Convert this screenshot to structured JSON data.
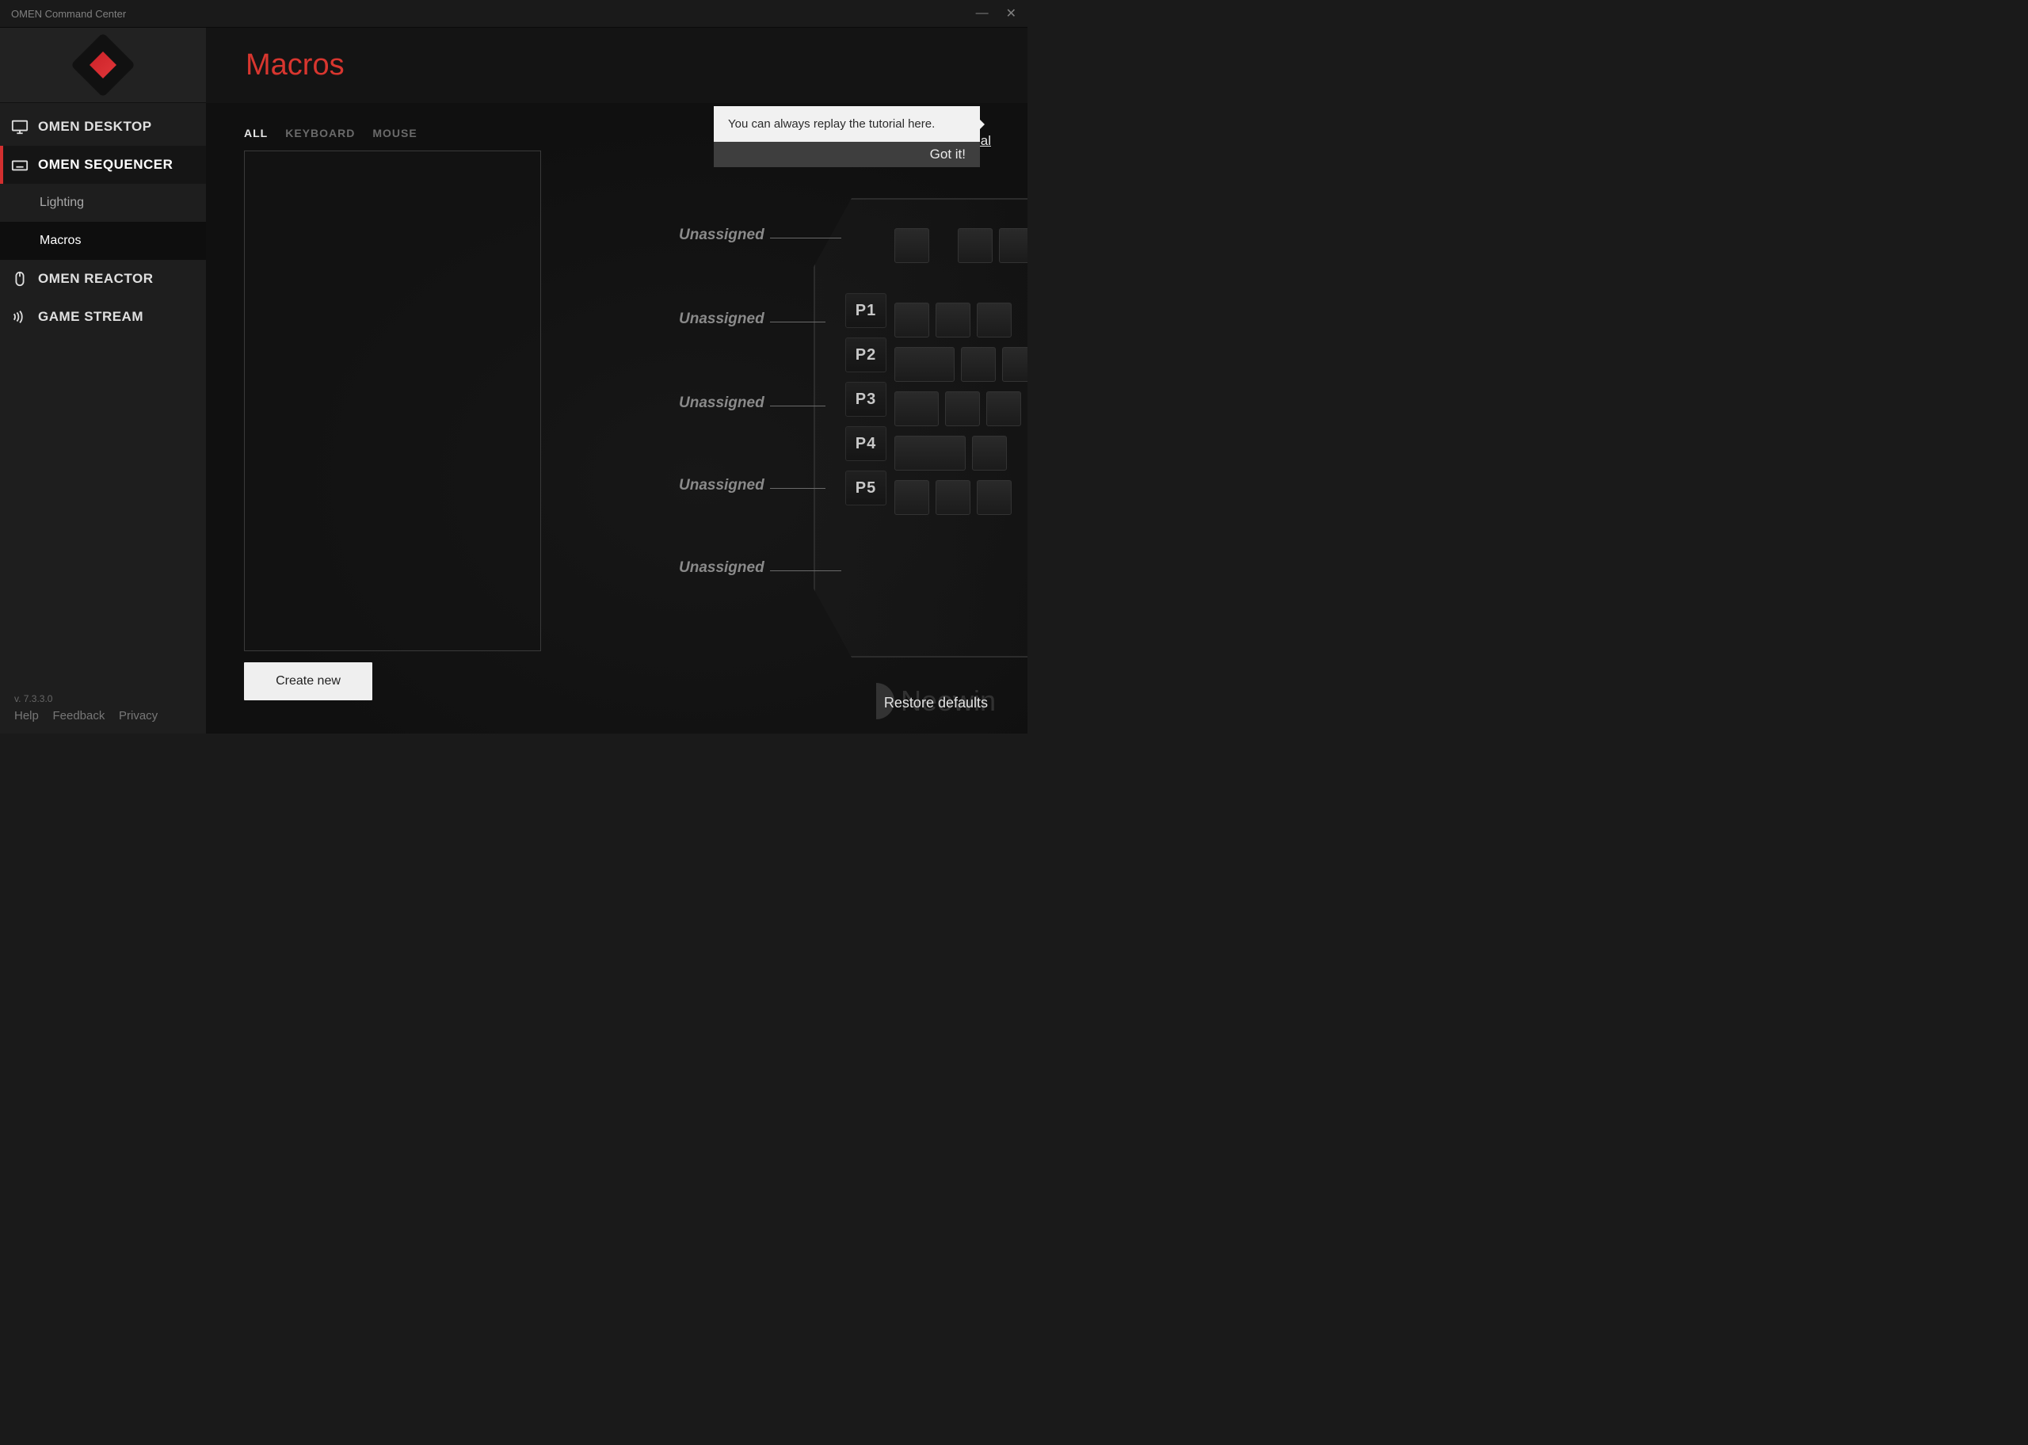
{
  "window": {
    "title": "OMEN Command Center"
  },
  "sidebar": {
    "items": [
      {
        "label": "OMEN DESKTOP"
      },
      {
        "label": "OMEN SEQUENCER"
      },
      {
        "label": "OMEN REACTOR"
      },
      {
        "label": "GAME STREAM"
      }
    ],
    "subitems": [
      {
        "label": "Lighting"
      },
      {
        "label": "Macros"
      }
    ],
    "version": "v. 7.3.3.0",
    "footer_links": {
      "help": "Help",
      "feedback": "Feedback",
      "privacy": "Privacy"
    }
  },
  "header": {
    "title": "Macros"
  },
  "filters": {
    "all": "ALL",
    "keyboard": "KEYBOARD",
    "mouse": "MOUSE"
  },
  "buttons": {
    "create_new": "Create new",
    "restore_defaults": "Restore defaults"
  },
  "tooltip": {
    "text": "You can always replay the tutorial here.",
    "dismiss": "Got it!",
    "link": "Tutorial"
  },
  "keys": {
    "labels": [
      "P1",
      "P2",
      "P3",
      "P4",
      "P5"
    ],
    "assign_state": "Unassigned"
  },
  "watermark": "Neowin"
}
